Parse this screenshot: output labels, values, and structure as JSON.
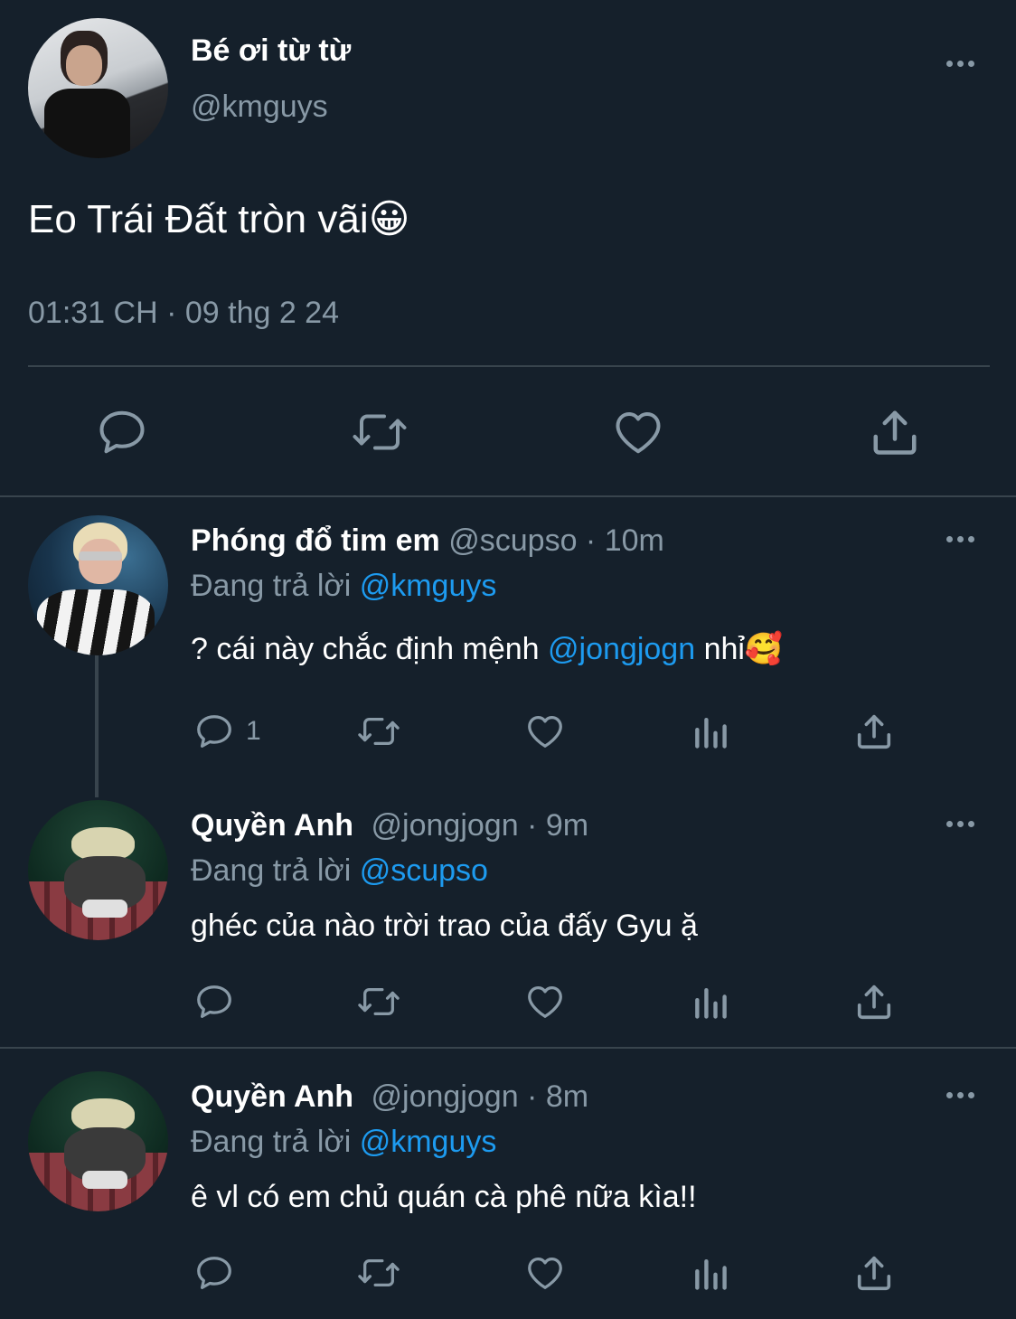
{
  "main_tweet": {
    "display_name": "Bé ơi từ từ",
    "handle": "@kmguys",
    "text": "Eo Trái Đất tròn vãi😀",
    "timestamp": "01:31 CH · 09 thg 2 24"
  },
  "replies": [
    {
      "display_name": "Phóng đổ tim em",
      "handle": "@scupso · 10m",
      "replying_prefix": "Đang trả lời",
      "replying_to": "@kmguys",
      "text_before": "? cái này chắc định mệnh",
      "mention": "@jongjogn",
      "text_after": "nhỉ🥰",
      "reply_count": "1"
    },
    {
      "display_name": "Quyền Anh",
      "handle": "@jongjogn · 9m",
      "replying_prefix": "Đang trả lời",
      "replying_to": "@scupso",
      "text": "ghéc của nào trời trao của đấy Gyu ặ"
    },
    {
      "display_name": "Quyền Anh",
      "handle": "@jongjogn · 8m",
      "replying_prefix": "Đang trả lời",
      "replying_to": "@kmguys",
      "text": "ê vl có em chủ quán cà phê nữa kìa!!"
    }
  ],
  "icons": {
    "reply": "reply-icon",
    "retweet": "retweet-icon",
    "like": "heart-icon",
    "views": "analytics-icon",
    "share": "share-icon",
    "more": "more-icon"
  },
  "colors": {
    "background": "#15202b",
    "muted": "#8899a6",
    "link": "#1d9bf0",
    "divider": "#38444d"
  }
}
